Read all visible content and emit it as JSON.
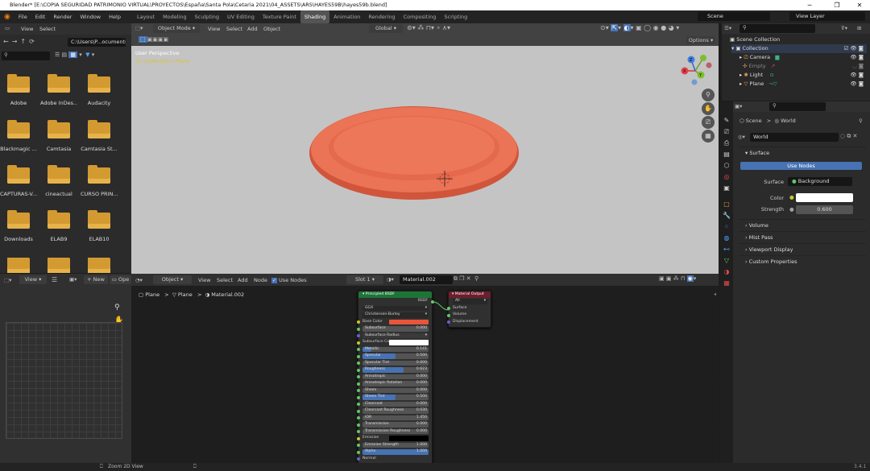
{
  "window": {
    "title": "Blender* [E:\\COPIA SEGURIDAD PATRIMONIO VIRTUAL\\PROYECTOS\\España\\Santa Pola\\Cetaria 2021\\04_ASSETS\\ARS\\HAYES59B\\hayes59b.blend]",
    "minimize": "─",
    "maximize": "❐",
    "close": "✕"
  },
  "menu": [
    "File",
    "Edit",
    "Render",
    "Window",
    "Help"
  ],
  "workspaces": [
    "Layout",
    "Modeling",
    "Sculpting",
    "UV Editing",
    "Texture Paint",
    "Shading",
    "Animation",
    "Rendering",
    "Compositing",
    "Scripting"
  ],
  "active_workspace": "Shading",
  "scene": "Scene",
  "view_layer": "View Layer",
  "filebrowser": {
    "view": "View",
    "select": "Select",
    "path": "C:\\Users\\P...ocuments\\",
    "folders": [
      "Adobe",
      "Adobe InDes...",
      "Audacity",
      "Blackmagic ...",
      "Camtasia",
      "Camtasia St...",
      "CAPTURAS-V...",
      "cineactual",
      "CURSO PRIN...",
      "Downloads",
      "ELAB9",
      "ELAB10",
      "",
      "",
      ""
    ]
  },
  "viewport": {
    "mode": "Object Mode",
    "menus": [
      "View",
      "Select",
      "Add",
      "Object"
    ],
    "orientation": "Global",
    "overlay1": "User Perspective",
    "overlay2": "(1) Collection | Plane",
    "options": "Options"
  },
  "image_editor": {
    "view": "View",
    "new": "New",
    "open": "Ope"
  },
  "node_editor": {
    "type": "Object",
    "menus": [
      "View",
      "Select",
      "Add",
      "Node"
    ],
    "use_nodes": "Use Nodes",
    "slot": "Slot 1",
    "material": "Material.002",
    "breadcrumb": [
      "Plane",
      "Plane",
      "Material.002"
    ]
  },
  "bsdf": {
    "title": "Principled BSDF",
    "out": "BSDF",
    "dist": "GGX",
    "sss": "Christensen-Burley",
    "rows": [
      {
        "l": "Base Color",
        "v": "",
        "t": "color",
        "c": "#e8553a",
        "s": "y"
      },
      {
        "l": "Subsurface",
        "v": "0.000",
        "t": "bar",
        "s": "g"
      },
      {
        "l": "Subsurface Radius",
        "v": "",
        "t": "drop",
        "s": "p"
      },
      {
        "l": "Subsurface Color",
        "v": "",
        "t": "color",
        "c": "#ffffff",
        "s": "y"
      },
      {
        "l": "Metallic",
        "v": "0.141",
        "t": "blue",
        "f": 0.14,
        "s": "g"
      },
      {
        "l": "Specular",
        "v": "0.500",
        "t": "blue",
        "f": 0.5,
        "s": "g"
      },
      {
        "l": "Specular Tint",
        "v": "0.000",
        "t": "bar",
        "s": "g"
      },
      {
        "l": "Roughness",
        "v": "0.623",
        "t": "blue",
        "f": 0.62,
        "s": "g"
      },
      {
        "l": "Anisotropic",
        "v": "0.000",
        "t": "bar",
        "s": "g"
      },
      {
        "l": "Anisotropic Rotation",
        "v": "0.000",
        "t": "bar",
        "s": "g"
      },
      {
        "l": "Sheen",
        "v": "0.000",
        "t": "bar",
        "s": "g"
      },
      {
        "l": "Sheen Tint",
        "v": "0.500",
        "t": "blue",
        "f": 0.5,
        "s": "g"
      },
      {
        "l": "Clearcoat",
        "v": "0.000",
        "t": "bar",
        "s": "g"
      },
      {
        "l": "Clearcoat Roughness",
        "v": "0.030",
        "t": "bar",
        "s": "g"
      },
      {
        "l": "IOR",
        "v": "1.450",
        "t": "bar",
        "s": "g"
      },
      {
        "l": "Transmission",
        "v": "0.000",
        "t": "bar",
        "s": "g"
      },
      {
        "l": "Transmission Roughness",
        "v": "0.000",
        "t": "bar",
        "s": "g"
      },
      {
        "l": "Emission",
        "v": "",
        "t": "color",
        "c": "#000000",
        "s": "y"
      },
      {
        "l": "Emission Strength",
        "v": "1.000",
        "t": "bar",
        "s": "g"
      },
      {
        "l": "Alpha",
        "v": "1.000",
        "t": "blue",
        "f": 1,
        "s": "g"
      },
      {
        "l": "Normal",
        "v": "",
        "t": "label",
        "s": "p"
      }
    ]
  },
  "matout": {
    "title": "Material Output",
    "target": "All",
    "sockets": [
      "Surface",
      "Volume",
      "Displacement"
    ]
  },
  "outliner": {
    "root": "Scene Collection",
    "items": [
      "Collection",
      "Camera",
      "Empty",
      "Light",
      "Plane"
    ]
  },
  "properties": {
    "crumb_scene": "Scene",
    "crumb_world": "World",
    "world_name": "World",
    "surface": "Surface",
    "use_nodes": "Use Nodes",
    "surface_label": "Surface",
    "surface_val": "Background",
    "color_label": "Color",
    "strength_label": "Strength",
    "strength_val": "0.600",
    "panels": [
      "Volume",
      "Mist Pass",
      "Viewport Display",
      "Custom Properties"
    ]
  },
  "statusbar": {
    "hint": "Zoom 2D View",
    "version": "3.4.1"
  }
}
